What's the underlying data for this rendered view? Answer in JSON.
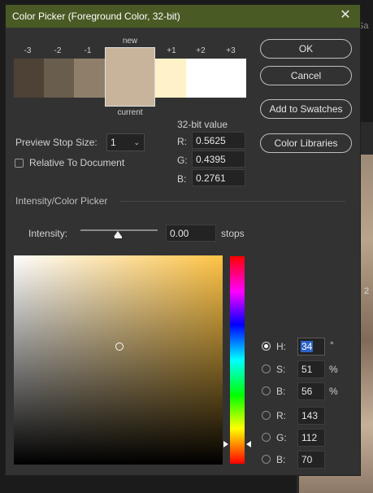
{
  "background": {
    "side_text": "Sa",
    "side_digit": "2"
  },
  "dialog": {
    "title": "Color Picker (Foreground Color, 32-bit)",
    "close_glyph": "✕",
    "stops": {
      "labels": [
        "-3",
        "-2",
        "-1",
        "+1",
        "+2",
        "+3"
      ],
      "new_label": "new",
      "current_label": "current",
      "colors": [
        "#4d4235",
        "#695d4d",
        "#8f7f6a",
        "#c7b49b",
        "#fff1c8",
        "#ffffff",
        "#ffffff"
      ]
    },
    "buttons": {
      "ok": "OK",
      "cancel": "Cancel",
      "add_to_swatches": "Add to Swatches",
      "color_libraries": "Color Libraries"
    },
    "preview_stop_size": {
      "label": "Preview Stop Size:",
      "value": "1"
    },
    "relative_to_document": {
      "label": "Relative To Document",
      "checked": false
    },
    "bit_value": {
      "heading": "32-bit value",
      "r": {
        "label": "R:",
        "value": "0.5625"
      },
      "g": {
        "label": "G:",
        "value": "0.4395"
      },
      "b": {
        "label": "B:",
        "value": "0.2761"
      }
    },
    "intensity_section": {
      "heading": "Intensity/Color Picker",
      "label": "Intensity:",
      "value": "0.00",
      "unit": "stops",
      "slider_fraction": 0.5
    },
    "picker": {
      "base_hue_color": "#ffc445",
      "cursor": "○",
      "hue_marker": "▶◀"
    },
    "hsb_rgb": {
      "h": {
        "label": "H:",
        "value": "34",
        "unit": "°",
        "selected": true
      },
      "s": {
        "label": "S:",
        "value": "51",
        "unit": "%"
      },
      "bri": {
        "label": "B:",
        "value": "56",
        "unit": "%"
      },
      "r": {
        "label": "R:",
        "value": "143"
      },
      "g": {
        "label": "G:",
        "value": "112"
      },
      "b": {
        "label": "B:",
        "value": "70"
      }
    }
  }
}
